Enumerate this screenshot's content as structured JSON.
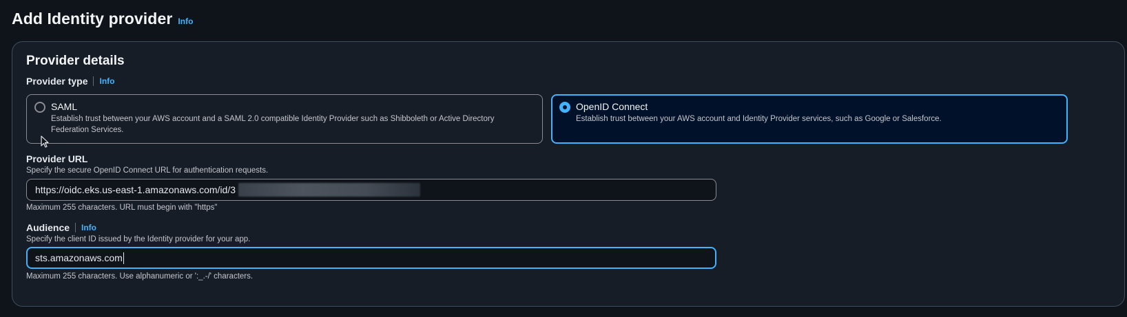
{
  "page": {
    "title": "Add Identity provider",
    "info_label": "Info"
  },
  "provider_details": {
    "title": "Provider details",
    "provider_type": {
      "label": "Provider type",
      "info_label": "Info",
      "selected": "OpenID Connect",
      "options": [
        {
          "title": "SAML",
          "description": "Establish trust between your AWS account and a SAML 2.0 compatible Identity Provider such as Shibboleth or Active Directory Federation Services."
        },
        {
          "title": "OpenID Connect",
          "description": "Establish trust between your AWS account and Identity Provider services, such as Google or Salesforce."
        }
      ]
    },
    "provider_url": {
      "label": "Provider URL",
      "description": "Specify the secure OpenID Connect URL for authentication requests.",
      "value": "https://oidc.eks.us-east-1.amazonaws.com/id/3",
      "constraint": "Maximum 255 characters. URL must begin with \"https\""
    },
    "audience": {
      "label": "Audience",
      "info_label": "Info",
      "description": "Specify the client ID issued by the Identity provider for your app.",
      "value": "sts.amazonaws.com",
      "constraint": "Maximum 255 characters. Use alphanumeric or ':_.-/' characters."
    }
  },
  "colors": {
    "background": "#0f141a",
    "container": "#161d26",
    "accent": "#42b4ff",
    "selected_tile": "#001129",
    "border": "#8c8c94"
  },
  "icons": {
    "pointer": "mouse-pointer-icon"
  }
}
